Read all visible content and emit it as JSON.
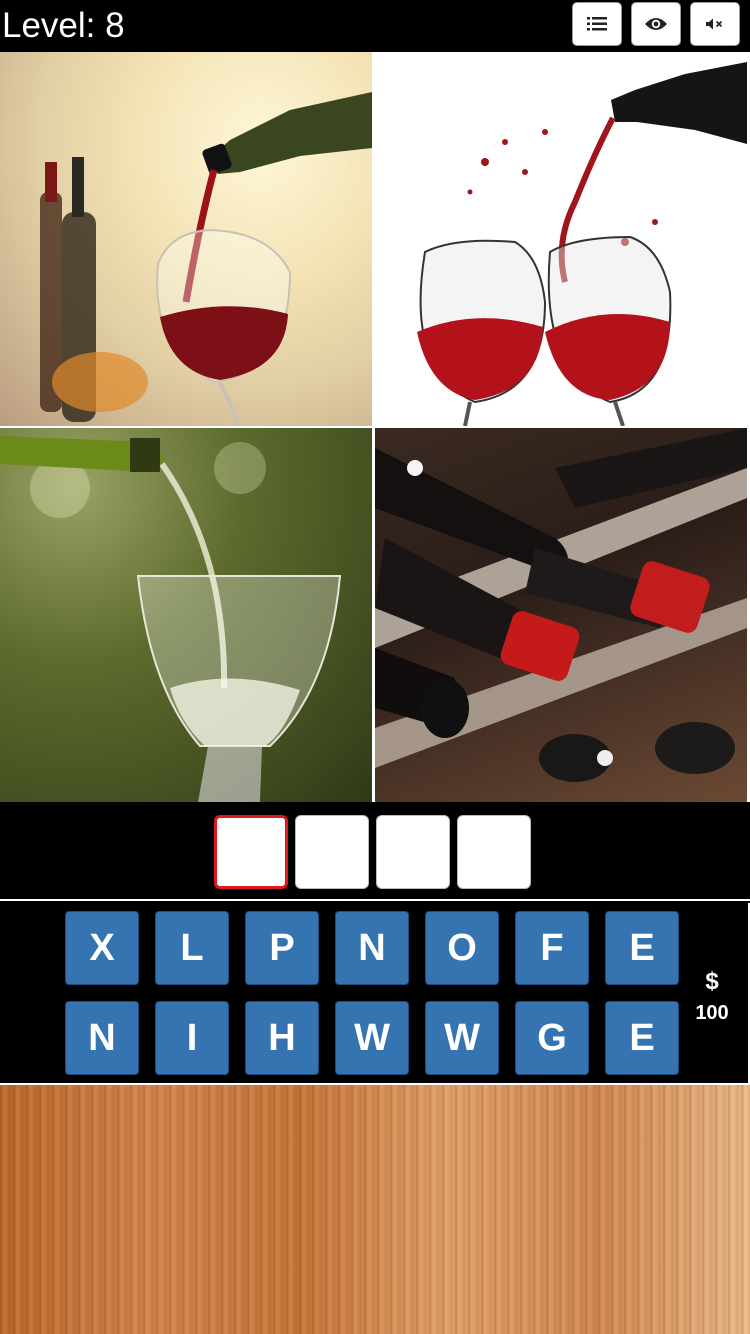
{
  "header": {
    "level_text": "Level: 8",
    "buttons": [
      {
        "icon": "list-icon"
      },
      {
        "icon": "eye-icon"
      },
      {
        "icon": "mute-icon"
      }
    ]
  },
  "images": [
    {
      "subject": "red-wine-pour-icon"
    },
    {
      "subject": "wine-glasses-toast-icon"
    },
    {
      "subject": "white-wine-pour-icon"
    },
    {
      "subject": "wine-bottle-rack-icon"
    }
  ],
  "answer": {
    "slots": [
      "",
      "",
      "",
      ""
    ],
    "active_index": 0
  },
  "letters": {
    "row1": [
      "X",
      "L",
      "P",
      "N",
      "O",
      "F",
      "E"
    ],
    "row2": [
      "N",
      "I",
      "H",
      "W",
      "W",
      "G",
      "E"
    ]
  },
  "coins": {
    "symbol": "$",
    "amount": "100"
  },
  "colors": {
    "key_blue": "#3573b1",
    "active_slot_border": "#e01a1a"
  }
}
